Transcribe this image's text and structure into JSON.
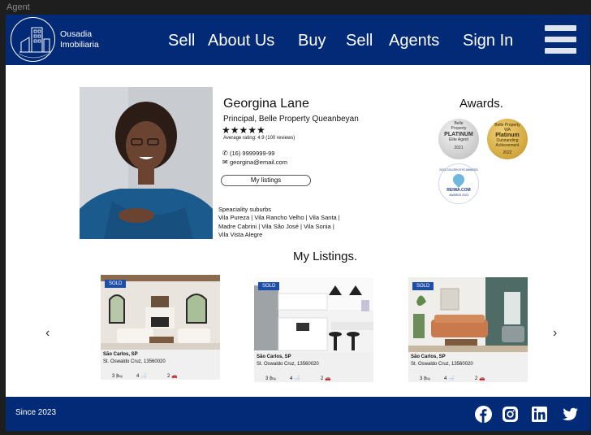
{
  "window": {
    "title": "Agent"
  },
  "header": {
    "brand_line1": "Ousadia",
    "brand_line2": "Imobiliaria",
    "logo_ring_text": "OUSADIA IMOBILIARIA",
    "nav": [
      "Sell",
      "About Us",
      "Buy",
      "Sell",
      "Agents",
      "Sign In"
    ],
    "menu_icon": "hamburger-icon"
  },
  "agent": {
    "name": "Georgina Lane",
    "role": "Principal, Belle Property Queanbeyan",
    "stars": "★★★★★",
    "rating_text": "Average rating: 4.9 (100 reviews)",
    "rating_value": 4.9,
    "phone": "(16) 9999999-99",
    "email": "georgina@email.com",
    "listings_button": "My listings",
    "suburbs_title": "Speaciality suburbs",
    "suburbs": [
      "Vila Pureza",
      "Vila Rancho Velho",
      "Vila Santa",
      "Madre Cabrini",
      "Vila São José",
      "Vila Sonia",
      "Vila Vista Alegre"
    ]
  },
  "awards": {
    "title": "Awards.",
    "items": [
      {
        "line1": "Belle",
        "line2": "Property",
        "big": "PLATINUM",
        "line3": "Elite Agent",
        "year": "2021",
        "color": "#c9c9c9"
      },
      {
        "line1": "Belle Property",
        "line2": "WA",
        "big": "Platinum",
        "line3": "Outstanding Achievement",
        "year": "2022",
        "color": "#d4a73a"
      },
      {
        "line1": "2023 GOLDEN EYE AWARDS",
        "line2": "",
        "big": "REIWA.COM",
        "line3": "AWARDS 2023",
        "year": "",
        "color": "#ffffff"
      }
    ]
  },
  "listings": {
    "title": "My Listings.",
    "prev_icon": "chevron-left-icon",
    "next_icon": "chevron-right-icon",
    "cards": [
      {
        "badge": "SOLD",
        "city": "São Carlos, SP",
        "street": "St. Oswaldo Cruz, 13560020",
        "beds": "3",
        "baths": "4",
        "cars": "2"
      },
      {
        "badge": "SOLD",
        "city": "São Carlos, SP",
        "street": "St. Oswaldo Cruz, 13560020",
        "beds": "3",
        "baths": "4",
        "cars": "2"
      },
      {
        "badge": "SOLD",
        "city": "São Carlos, SP",
        "street": "St. Oswaldo Cruz, 13560020",
        "beds": "3",
        "baths": "4",
        "cars": "2"
      }
    ]
  },
  "footer": {
    "since": "Since 2023",
    "social": [
      "facebook-icon",
      "instagram-icon",
      "linkedin-icon",
      "twitter-icon"
    ]
  },
  "colors": {
    "brand": "#022a76",
    "badge": "#1d4ea8"
  }
}
